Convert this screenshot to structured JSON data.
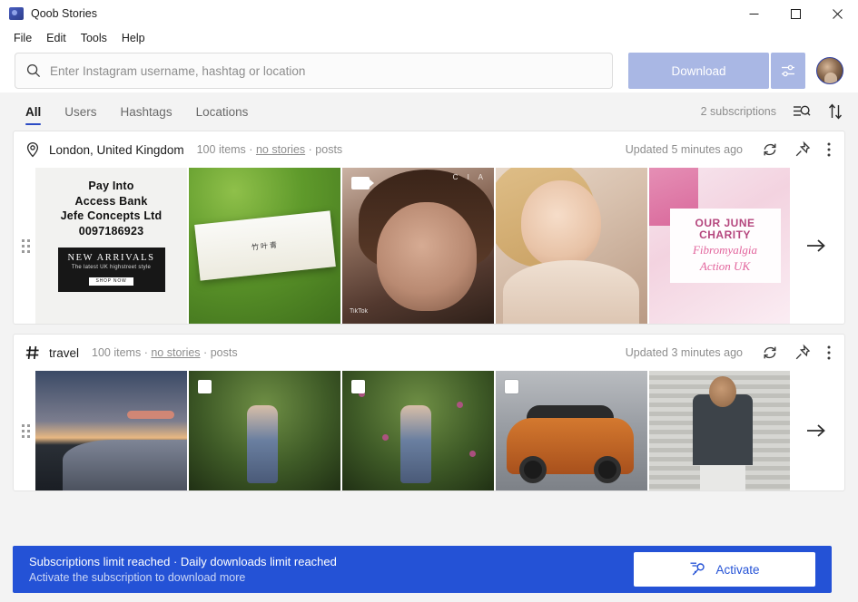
{
  "window": {
    "title": "Qoob Stories",
    "app_icon": "app-logo-icon",
    "controls": {
      "minimize": "Minimize",
      "maximize": "Maximize",
      "close": "Close"
    }
  },
  "menubar": {
    "items": [
      "File",
      "Edit",
      "Tools",
      "Help"
    ]
  },
  "search": {
    "placeholder": "Enter Instagram username, hashtag or location",
    "value": "",
    "icon": "search-icon",
    "download_label": "Download",
    "settings_icon": "sliders-settings-icon",
    "avatar": "user-avatar"
  },
  "tabs": {
    "items": [
      {
        "label": "All",
        "active": true
      },
      {
        "label": "Users",
        "active": false
      },
      {
        "label": "Hashtags",
        "active": false
      },
      {
        "label": "Locations",
        "active": false
      }
    ],
    "subscriptions_count": "2 subscriptions",
    "filter_icon": "filter-search-icon",
    "sort_icon": "sort-arrows-icon"
  },
  "cards": [
    {
      "type": "location",
      "type_icon": "location-pin-icon",
      "title": "London, United Kingdom",
      "items_count": "100 items",
      "separator": "·",
      "stories_link": "no stories",
      "posts_label": "posts",
      "updated": "Updated 5 minutes ago",
      "refresh_icon": "refresh-icon",
      "pin_icon": "pin-icon",
      "menu_icon": "more-vertical-icon",
      "drag_handle": "drag-handle-icon",
      "next_icon": "arrow-right-icon",
      "thumbs": [
        {
          "name": "promo-bank-details",
          "badge": "",
          "line1": "Pay Into",
          "line2": "Access Bank",
          "line3": "Jefe Concepts Ltd",
          "line4": "0097186923",
          "banner_head": "NEW ARRIVALS",
          "banner_sub": "The latest UK highstreet style",
          "banner_btn": "SHOP NOW"
        },
        {
          "name": "product-box-on-grass",
          "badge": "",
          "caption": "竹叶青"
        },
        {
          "name": "video-selfie-woman",
          "badge": "video-badge-icon",
          "corner_text": "C I A",
          "watermark": "TikTok"
        },
        {
          "name": "portrait-blonde-woman",
          "badge": ""
        },
        {
          "name": "charity-poster",
          "badge": "",
          "line1": "OUR JUNE",
          "line2": "CHARITY",
          "line3": "Fibromyalgia",
          "line4": "Action UK"
        }
      ]
    },
    {
      "type": "hashtag",
      "type_icon": "hashtag-icon",
      "title": "travel",
      "items_count": "100 items",
      "separator": "·",
      "stories_link": "no stories",
      "posts_label": "posts",
      "updated": "Updated 3 minutes ago",
      "refresh_icon": "refresh-icon",
      "pin_icon": "pin-icon",
      "menu_icon": "more-vertical-icon",
      "drag_handle": "drag-handle-icon",
      "next_icon": "arrow-right-icon",
      "thumbs": [
        {
          "name": "sunset-over-water",
          "badge": ""
        },
        {
          "name": "woman-in-forest",
          "badge": "multi-photo-badge-icon"
        },
        {
          "name": "woman-by-flowers",
          "badge": "multi-photo-badge-icon"
        },
        {
          "name": "orange-vintage-car",
          "badge": "multi-photo-badge-icon"
        },
        {
          "name": "man-by-blinds",
          "badge": ""
        }
      ]
    }
  ],
  "banner": {
    "line1": "Subscriptions limit reached · Daily downloads limit reached",
    "line2": "Activate the subscription to download more",
    "button_label": "Activate",
    "button_icon": "key-activate-icon",
    "background_color": "#2452d6"
  }
}
